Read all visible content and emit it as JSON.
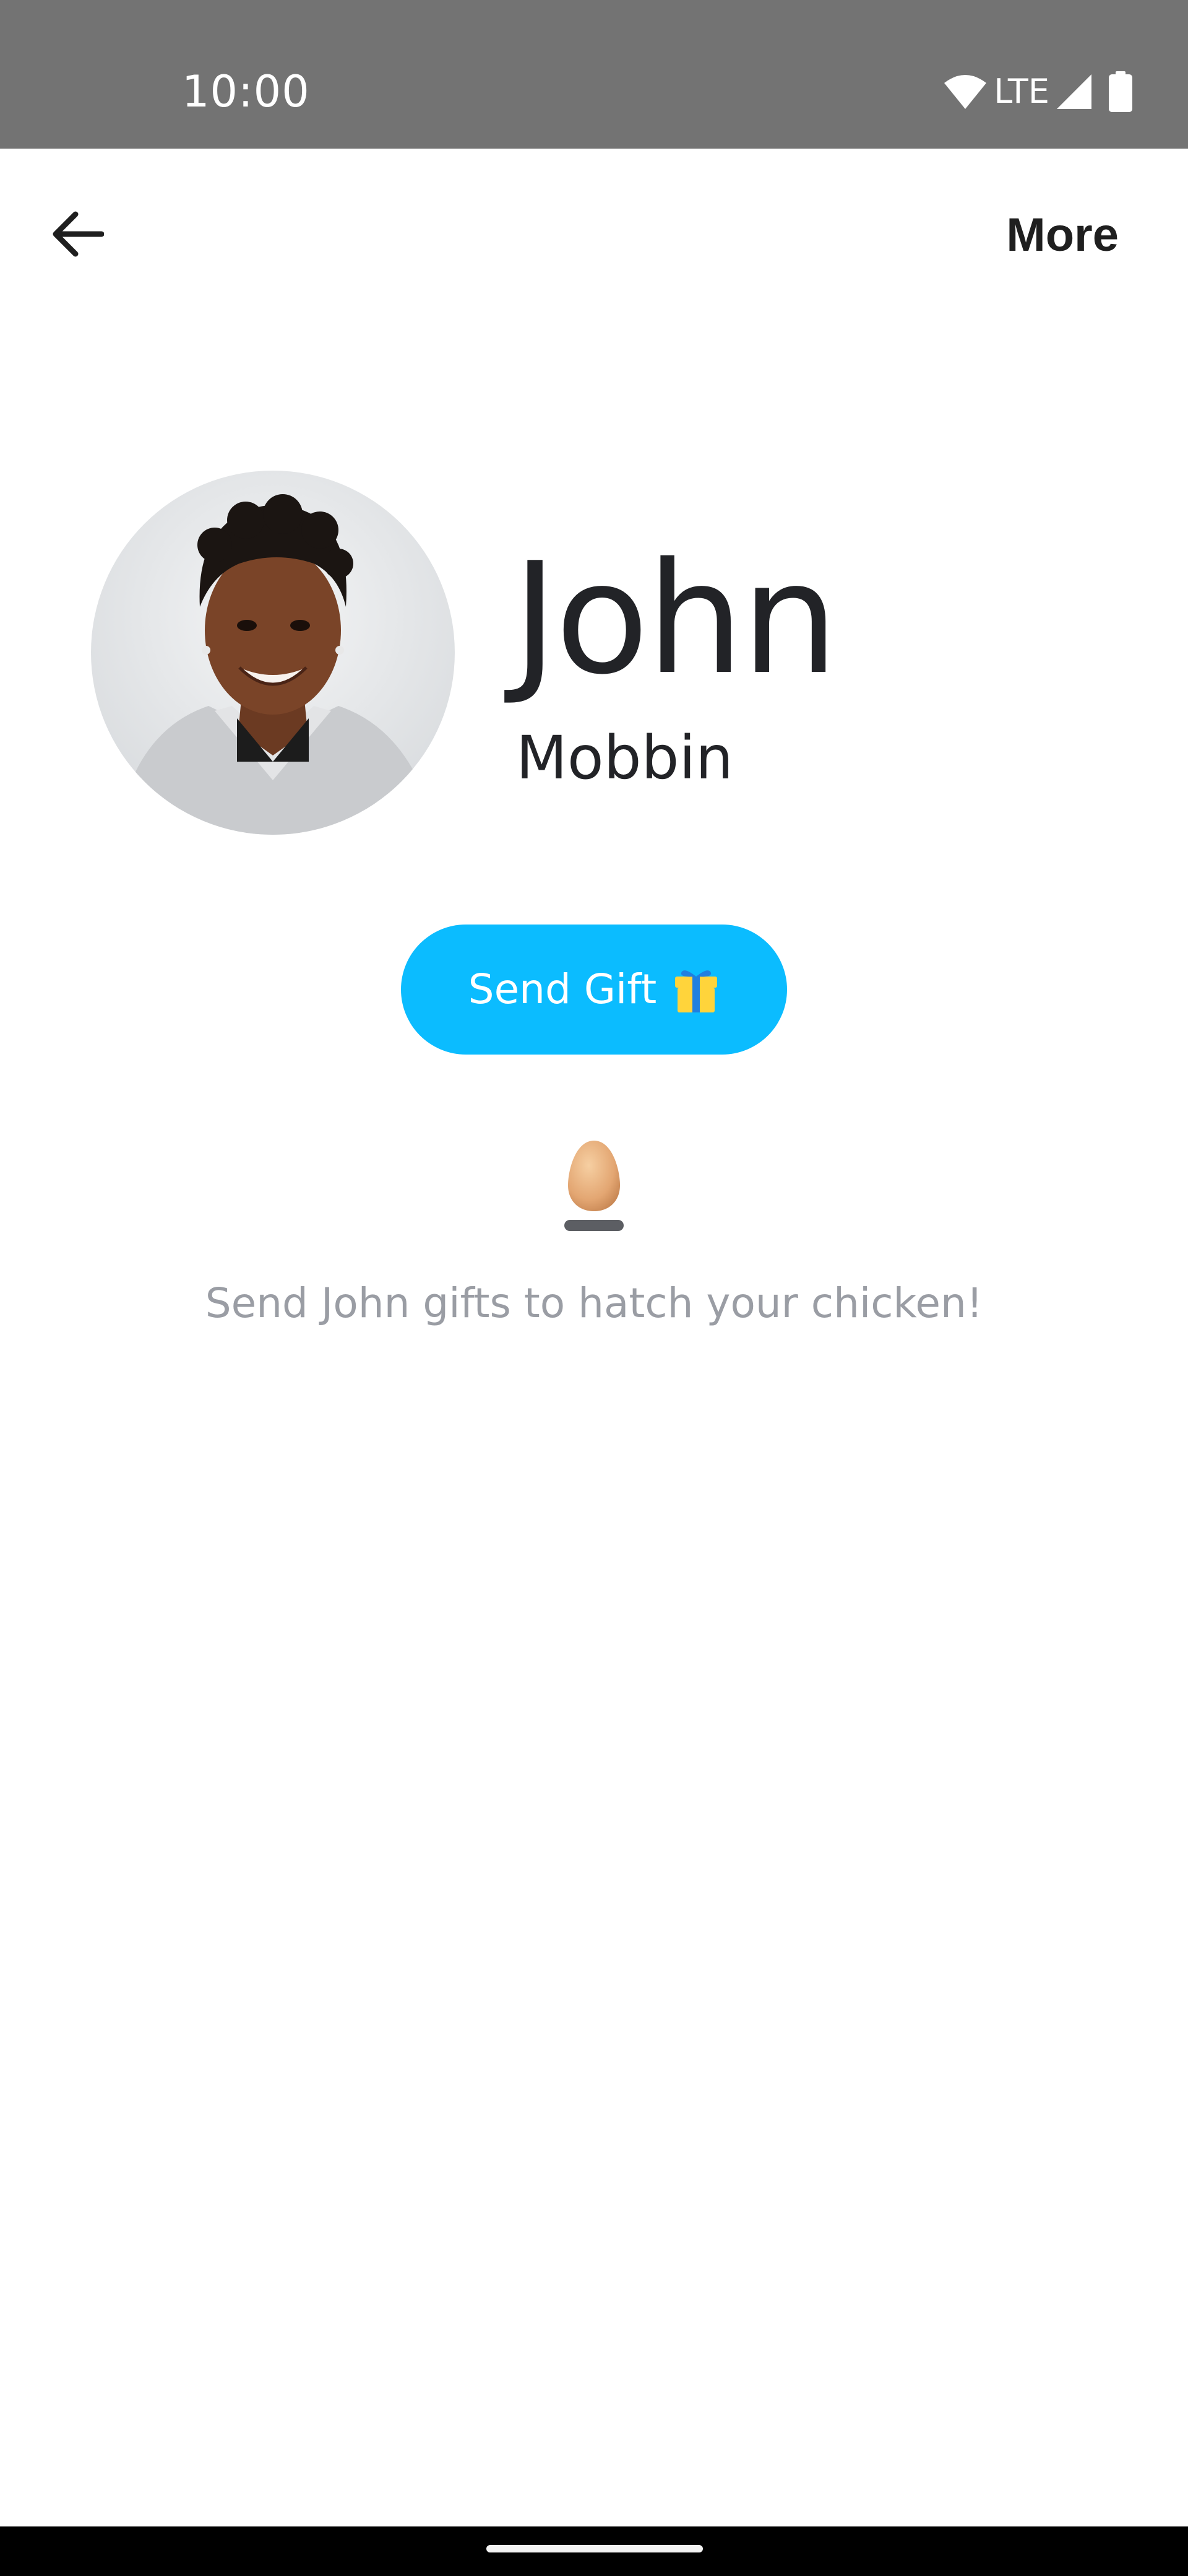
{
  "status_bar": {
    "time": "10:00",
    "network_label": "LTE",
    "icons": [
      "wifi-icon",
      "cellular-signal-icon",
      "battery-icon"
    ]
  },
  "app_bar": {
    "back_icon": "arrow-left-icon",
    "more_label": "More"
  },
  "profile": {
    "name": "John",
    "surname": "Mobbin",
    "avatar": "avatar"
  },
  "actions": {
    "send_gift_label": "Send Gift",
    "send_gift_icon": "gift-icon"
  },
  "hatch": {
    "icon": "egg-icon",
    "message": "Send John gifts to hatch your chicken!"
  },
  "colors": {
    "status_bar_bg": "#737373",
    "accent": "#0bbcff",
    "text_primary": "#222327",
    "text_secondary": "#9a9da4"
  }
}
